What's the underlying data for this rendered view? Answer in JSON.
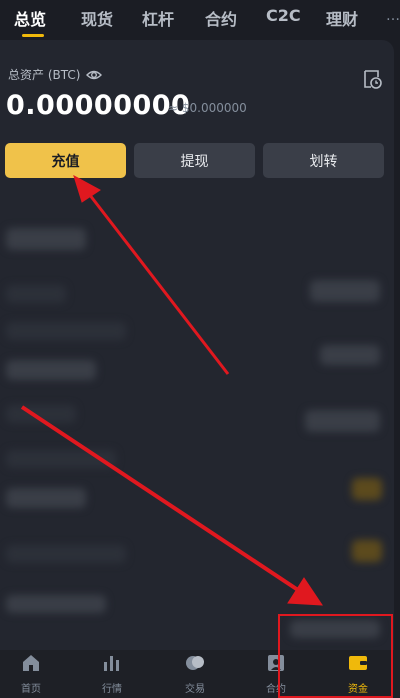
{
  "tabs": [
    {
      "label": "总览",
      "active": true
    },
    {
      "label": "现货",
      "active": false
    },
    {
      "label": "杠杆",
      "active": false
    },
    {
      "label": "合约",
      "active": false
    },
    {
      "label": "C2C",
      "active": false
    },
    {
      "label": "理财",
      "active": false
    }
  ],
  "tabs_more": "…",
  "summary": {
    "label": "总资产 (BTC)",
    "balance": "0.00000000",
    "fiat": "≈ $0.000000"
  },
  "actions": {
    "deposit": "充值",
    "withdraw": "提现",
    "transfer": "划转"
  },
  "bottom_nav": [
    {
      "label": "首页",
      "icon": "home-icon",
      "active": false
    },
    {
      "label": "行情",
      "icon": "market-icon",
      "active": false
    },
    {
      "label": "交易",
      "icon": "trade-icon",
      "active": false
    },
    {
      "label": "合约",
      "icon": "futures-icon",
      "active": false
    },
    {
      "label": "资金",
      "icon": "wallet-icon",
      "active": true
    }
  ],
  "colors": {
    "background": "#1b1d24",
    "card": "#23262f",
    "accent": "#f0b90b",
    "deposit_button": "#f0c24a",
    "annotation": "#e0181f"
  }
}
